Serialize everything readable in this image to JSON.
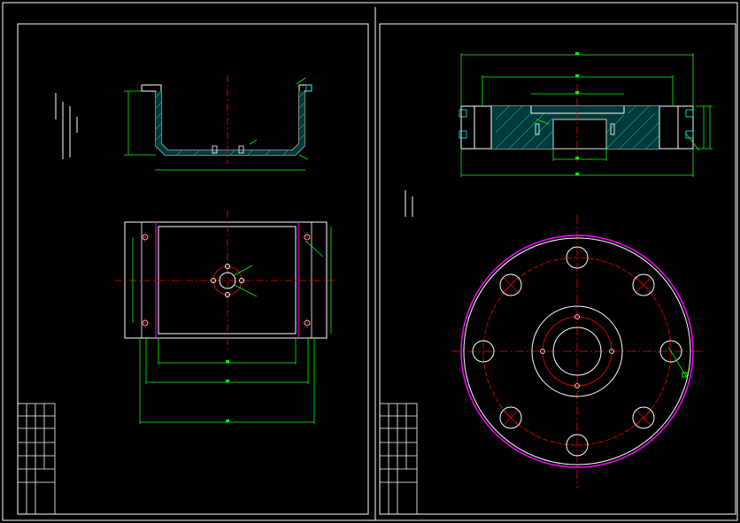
{
  "colors": {
    "background": "#000000",
    "frame": "#ffffff",
    "dimension": "#00ff00",
    "centerline": "#ff0000",
    "hidden": "#ff00ff",
    "hatch": "#00ffff",
    "outline": "#ffffff"
  },
  "drawing_sheets": [
    {
      "name": "left-sheet",
      "views": [
        "section-view-bowl",
        "plan-view-rectangle"
      ]
    },
    {
      "name": "right-sheet",
      "views": [
        "section-view-flange",
        "plan-view-circle"
      ]
    }
  ]
}
